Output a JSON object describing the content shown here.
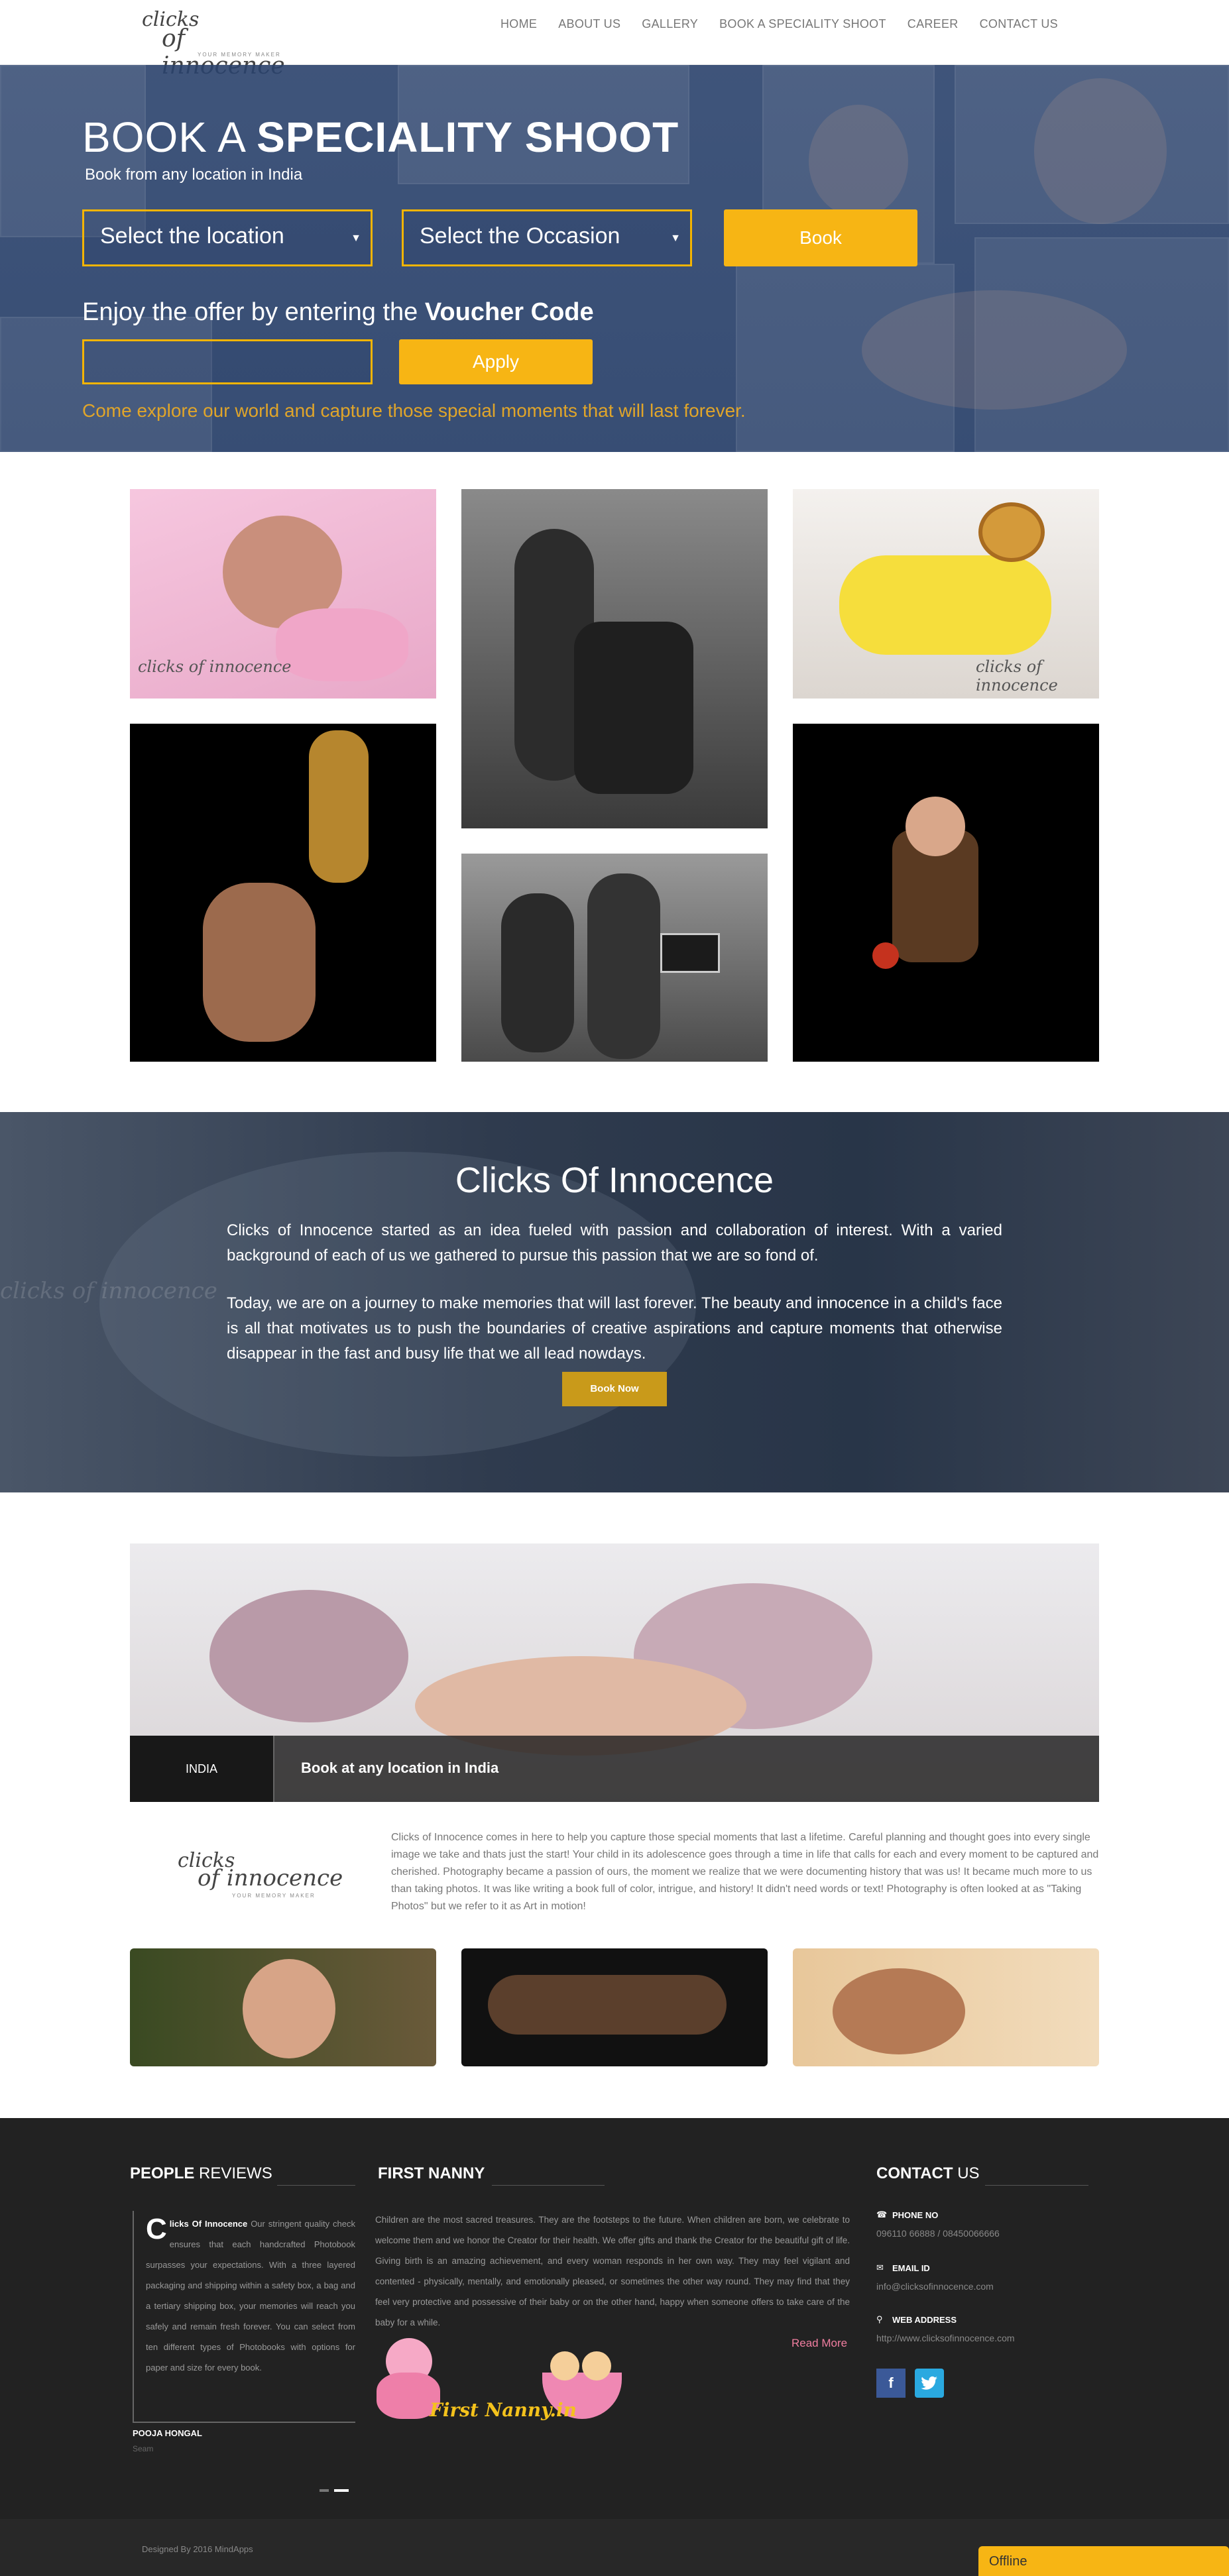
{
  "nav": {
    "logo_text_top": "clicks",
    "logo_text_bottom": "of innocence",
    "logo_tagline": "YOUR MEMORY MAKER",
    "menu": [
      "HOME",
      "ABOUT US",
      "GALLERY",
      "BOOK A SPECIALITY SHOOT",
      "CAREER",
      "CONTACT US"
    ]
  },
  "hero": {
    "title_light": "BOOK A",
    "title_bold": "SPECIALITY SHOOT",
    "subtitle": "Book from any location in India",
    "location_select": "Select the location",
    "occasion_select": "Select the Occasion",
    "book_button": "Book",
    "voucher_prefix": "Enjoy the offer by entering the",
    "voucher_bold": "Voucher Code",
    "voucher_value": "",
    "apply_button": "Apply",
    "tagline": "Come explore our world and capture those special moments that will last forever."
  },
  "gallery": {
    "watermark": "clicks of innocence"
  },
  "about": {
    "title": "Clicks Of Innocence",
    "para1": "Clicks of Innocence started as an idea fueled with passion and collaboration of interest. With a varied background of each of us we gathered to pursue this passion that we are so fond of.",
    "para2": "Today, we are on a journey to make memories that will last forever. The beauty and innocence in a child's face is all that motivates us to push the boundaries of creative aspirations and capture moments that otherwise disappear in the fast and busy life that we all lead nowdays.",
    "button": "Book Now"
  },
  "banner": {
    "country": "INDIA",
    "caption": "Book at any location in India"
  },
  "intro": {
    "text": "Clicks of Innocence comes in here to help you capture those special moments that last a lifetime. Careful planning and thought goes into every single image we take and thats just the start! Your child in its adolescence goes through a time in life that calls for each and every moment to be captured and cherished. Photography became a passion of ours, the moment we realize that we were documenting history that was us! It became much more to us than taking photos. It was like writing a book full of color, intrigue, and history! It didn't need words or text! Photography is often looked at as \"Taking Photos\" but we refer to it as Art in motion!"
  },
  "footer": {
    "reviews_heading_bold": "PEOPLE",
    "reviews_heading_light": "REVIEWS",
    "review_dropcap": "C",
    "review_brand": "licks Of Innocence",
    "review_text": "Our stringent quality check ensures that each handcrafted Photobook surpasses your expectations. With a three layered packaging and shipping within a safety box, a bag and a tertiary shipping box, your memories will reach you safely and remain fresh forever. You can select from ten different types of Photobooks with options for paper and size for every book.",
    "reviewer_name": "POOJA HONGAL",
    "reviewer_sub": "Seam",
    "nanny_heading": "FIRST NANNY",
    "nanny_text": "Children are the most sacred treasures. They are the footsteps to the future. When children are born, we celebrate to welcome them and we honor the Creator for their health. We offer gifts and thank the Creator for the beautiful gift of life. Giving birth is an amazing achievement, and every woman responds in her own way. They may feel vigilant and contented - physically, mentally, and emotionally pleased, or sometimes the other way round. They may find that they feel very protective and possessive of their baby or on the other hand, happy when someone offers to take care of the baby for a while.",
    "read_more": "Read More",
    "nanny_logo": "First Nanny.in",
    "contact_heading_bold": "CONTACT",
    "contact_heading_light": "US",
    "phone_label": "PHONE NO",
    "phone_value": "096110 66888 / 08450066666",
    "email_label": "EMAIL ID",
    "email_value": "info@clicksofinnocence.com",
    "web_label": "WEB ADDRESS",
    "web_value": "http://www.clicksofinnocence.com",
    "facebook": "f",
    "copyright": "Designed By 2016 MindApps",
    "chat": "Offline"
  },
  "colors": {
    "accent": "#f7b514",
    "hero_blue": "#2d4570",
    "footer_bg": "#222222",
    "read_more": "#f07ea0"
  }
}
